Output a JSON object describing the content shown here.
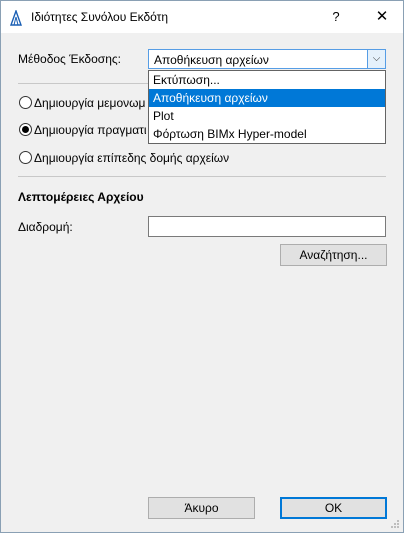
{
  "window": {
    "title": "Ιδιότητες Συνόλου Εκδότη",
    "help_glyph": "?",
    "close_glyph": "✕"
  },
  "method": {
    "label": "Μέθοδος Έκδοσης:",
    "selected": "Αποθήκευση αρχείων",
    "options": [
      "Εκτύπωση...",
      "Αποθήκευση αρχείων",
      "Plot",
      "Φόρτωση BIMx Hyper-model"
    ],
    "selected_index": 1
  },
  "radios": [
    {
      "label": "Δημιουργία μεμονωμ",
      "checked": false
    },
    {
      "label": "Δημιουργία πραγματι",
      "checked": true
    },
    {
      "label": "Δημιουργία επίπεδης δομής αρχείων",
      "checked": false
    }
  ],
  "file_details": {
    "heading": "Λεπτομέρειες Αρχείου",
    "path_label": "Διαδρομή:",
    "path_value": "",
    "browse_label": "Αναζήτηση..."
  },
  "footer": {
    "cancel_label": "Άκυρο",
    "ok_label": "OK"
  },
  "colors": {
    "accent": "#0078d7",
    "titlebar": "#ffffff",
    "dialog_bg": "#f0f0f0"
  }
}
